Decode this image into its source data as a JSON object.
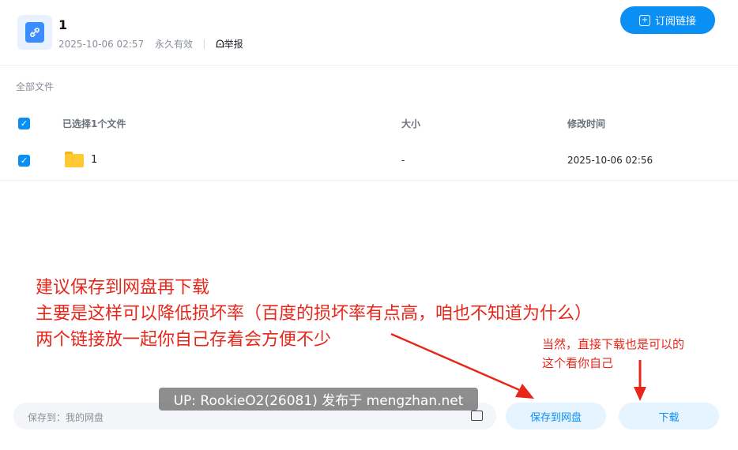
{
  "header": {
    "title": "1",
    "date": "2025-10-06 02:57",
    "validity": "永久有效",
    "report_label": "举报",
    "subscribe_label": "订阅链接"
  },
  "breadcrumb": "全部文件",
  "table": {
    "headers": [
      "已选择1个文件",
      "大小",
      "修改时间"
    ],
    "rows": [
      {
        "name": "1",
        "size": "-",
        "modified": "2025-10-06 02:56",
        "checked": true
      }
    ]
  },
  "annotations": {
    "main_lines": [
      "建议保存到网盘再下载",
      "主要是这样可以降低损坏率（百度的损坏率有点高，咱也不知道为什么）",
      "两个链接放一起你自己存着会方便不少"
    ],
    "side_lines": [
      "当然，直接下载也是可以的",
      "这个看你自己"
    ]
  },
  "watermark": "UP: RookieO2(26081) 发布于 mengzhan.net",
  "footer": {
    "save_to_label": "保存到：我的网盘",
    "save_button": "保存到网盘",
    "download_button": "下载"
  },
  "colors": {
    "accent": "#0a8ff5",
    "annotation": "#e8271b"
  },
  "icons": [
    "share-link-icon",
    "report-icon",
    "plus-square-icon",
    "check-icon",
    "folder-icon",
    "folder-outline-icon"
  ]
}
